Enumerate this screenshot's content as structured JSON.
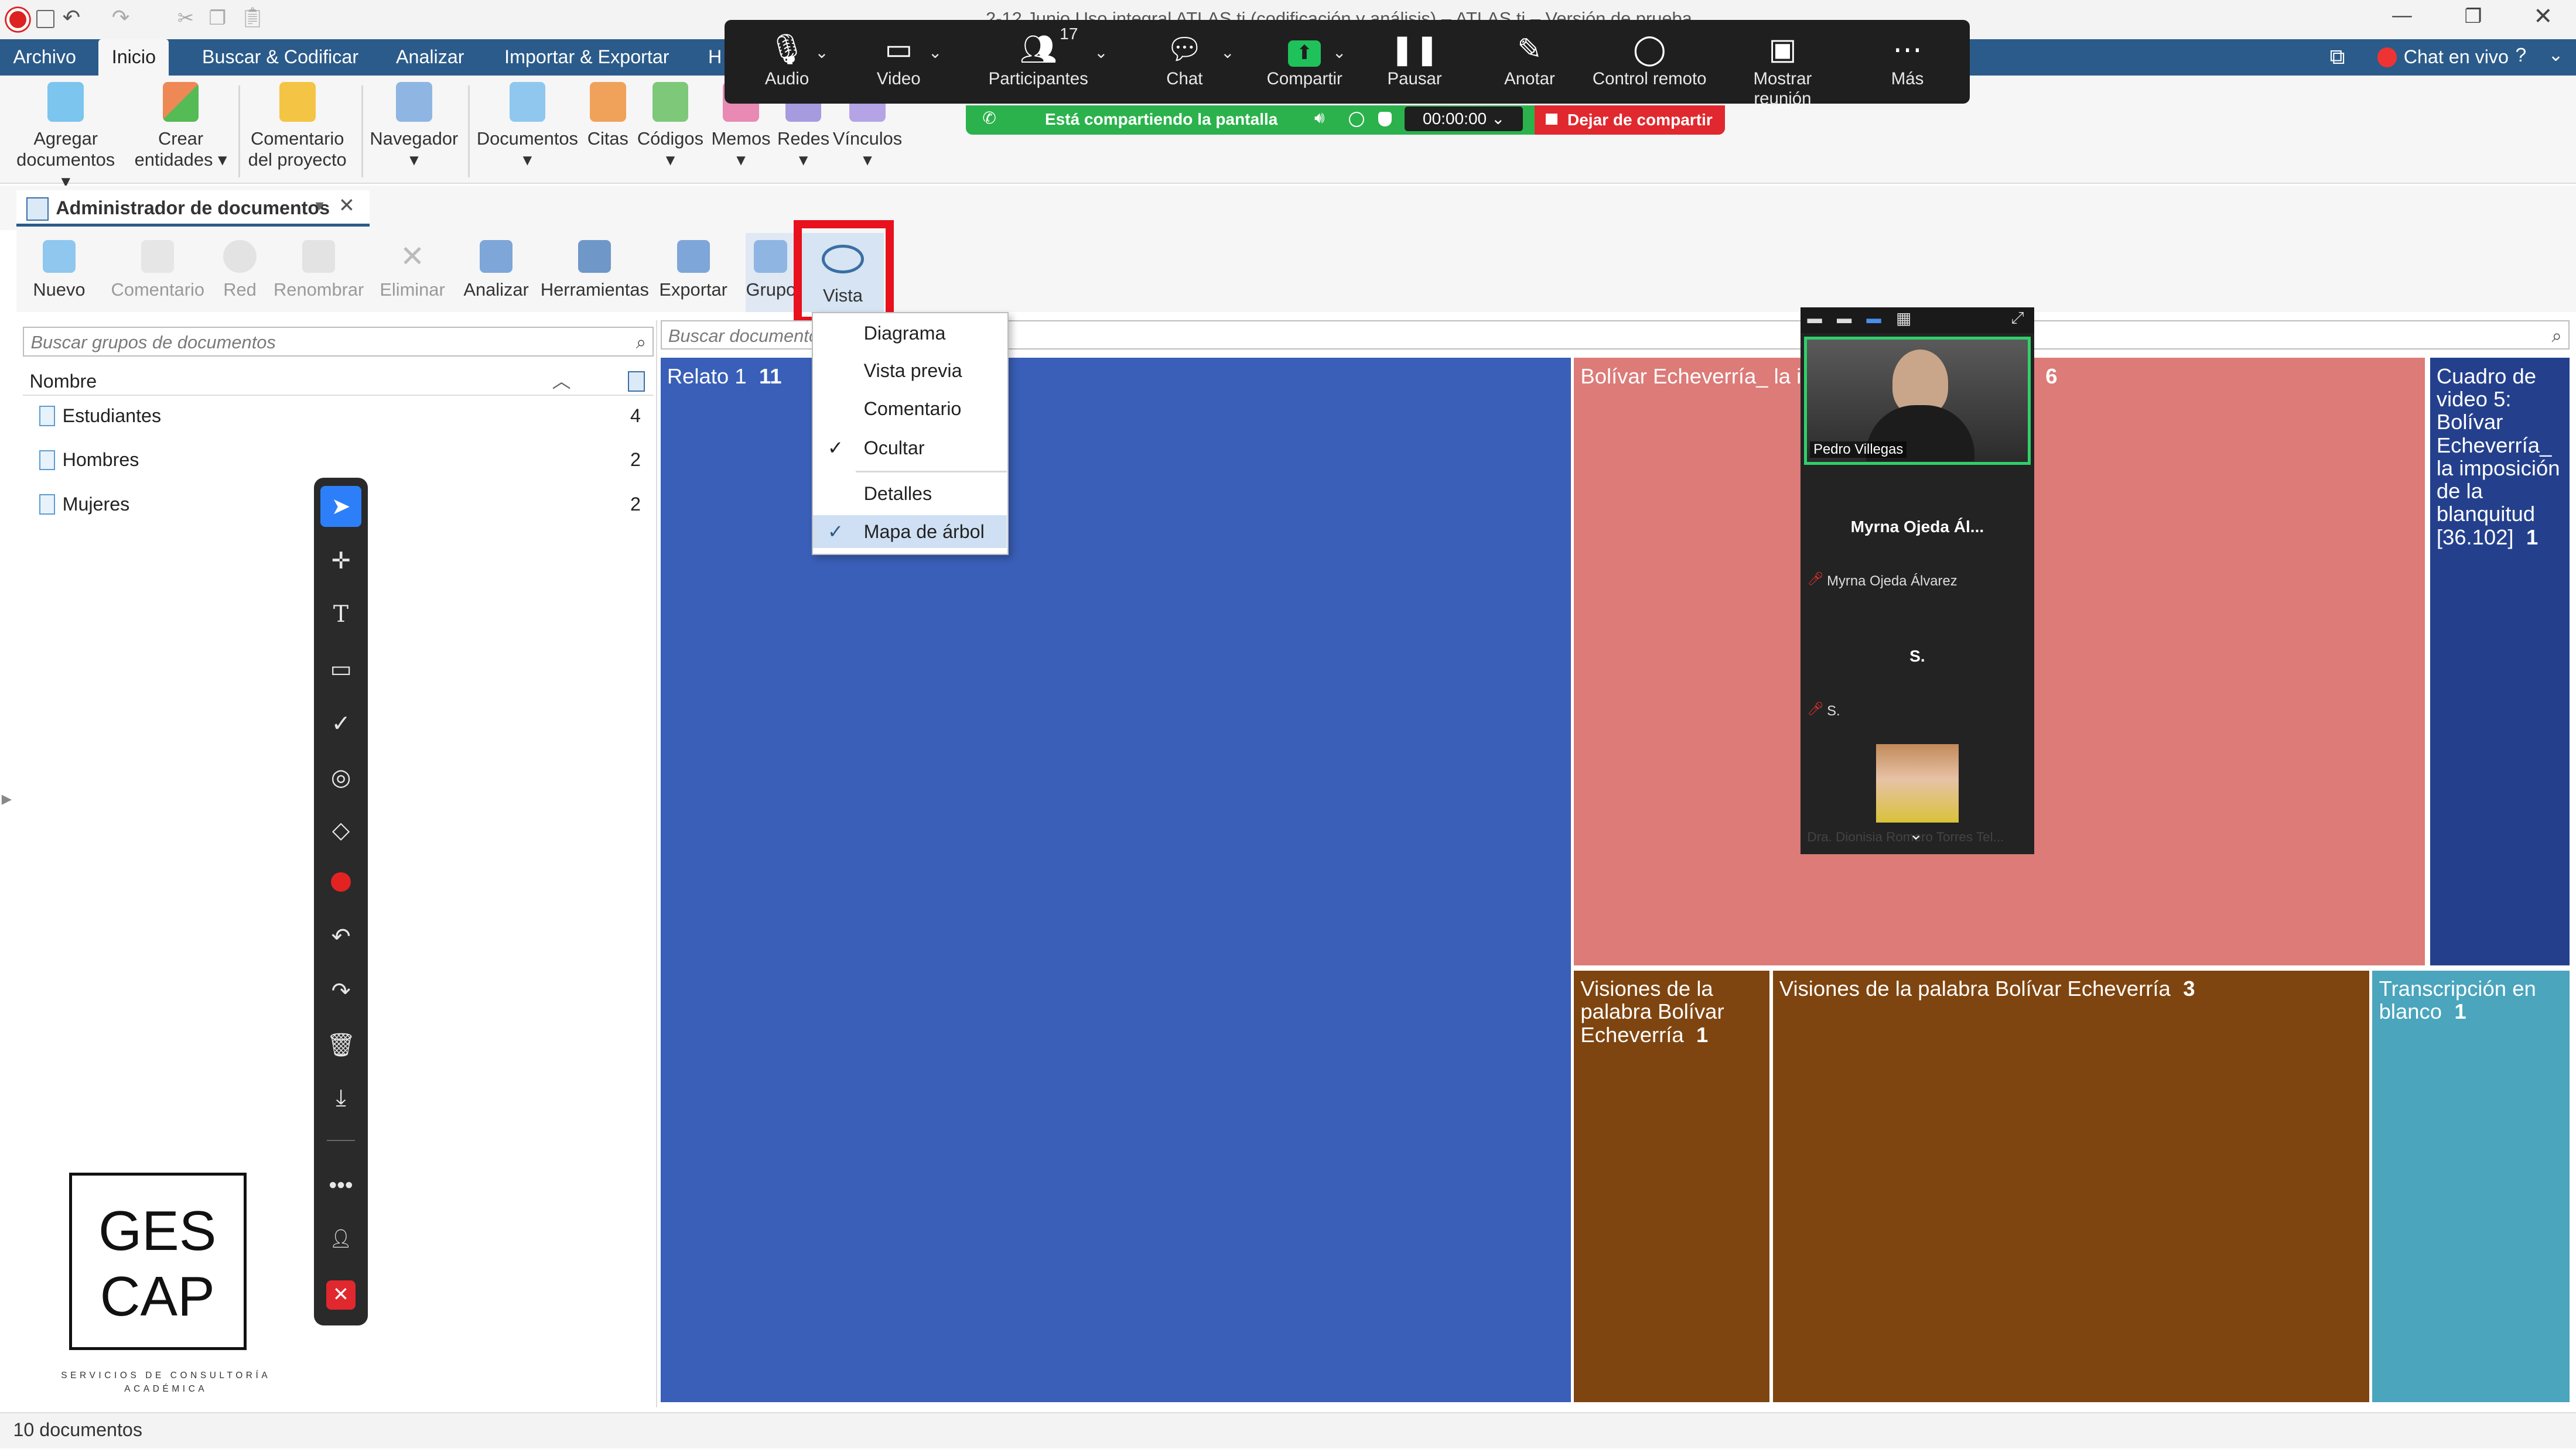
{
  "window": {
    "title": "2-12 Junio Uso integral ATLAS.ti (codificación y análisis) – ATLAS.ti – Versión de prueba"
  },
  "menubar": {
    "items": [
      "Archivo",
      "Inicio",
      "Buscar & Codificar",
      "Analizar",
      "Importar & Exportar",
      "H"
    ],
    "chat_label": "Chat en vivo"
  },
  "ribbon": {
    "buttons": [
      {
        "label": "Agregar\ndocumentos",
        "icon": "add-document-icon"
      },
      {
        "label": "Crear\nentidades",
        "icon": "create-entities-icon"
      },
      {
        "label": "Comentario\ndel proyecto",
        "icon": "comment-icon"
      },
      {
        "label": "Navegador",
        "icon": "navigator-icon"
      },
      {
        "label": "Documentos",
        "icon": "documents-icon"
      },
      {
        "label": "Citas",
        "icon": "quotes-icon"
      },
      {
        "label": "Códigos",
        "icon": "codes-icon"
      },
      {
        "label": "Memos",
        "icon": "memos-icon"
      },
      {
        "label": "Redes",
        "icon": "networks-icon"
      },
      {
        "label": "Vínculos",
        "icon": "links-icon"
      }
    ]
  },
  "doc_manager": {
    "tab_title": "Administrador de documentos",
    "toolbar": [
      {
        "label": "Nuevo",
        "enabled": true
      },
      {
        "label": "Comentario",
        "enabled": false
      },
      {
        "label": "Red",
        "enabled": false
      },
      {
        "label": "Renombrar",
        "enabled": false
      },
      {
        "label": "Eliminar",
        "enabled": false
      },
      {
        "label": "Analizar",
        "enabled": true
      },
      {
        "label": "Herramientas",
        "enabled": true
      },
      {
        "label": "Exportar",
        "enabled": true
      },
      {
        "label": "Grupo",
        "enabled": true
      },
      {
        "label": "Vista",
        "enabled": true
      }
    ],
    "group_search_placeholder": "Buscar grupos de documentos",
    "doc_search_placeholder": "Buscar documentos",
    "column_name": "Nombre",
    "groups": [
      {
        "name": "Estudiantes",
        "count": "4"
      },
      {
        "name": "Hombres",
        "count": "2"
      },
      {
        "name": "Mujeres",
        "count": "2"
      }
    ],
    "status": "10 documentos"
  },
  "view_menu": {
    "items": [
      {
        "label": "Diagrama",
        "checked": false
      },
      {
        "label": "Vista previa",
        "checked": false
      },
      {
        "label": "Comentario",
        "checked": false
      },
      {
        "label": "Ocultar",
        "checked": true
      },
      {
        "label": "Detalles",
        "checked": false
      },
      {
        "label": "Mapa de árbol",
        "checked": true
      }
    ]
  },
  "treemap": [
    {
      "title": "Relato 1",
      "count": "11",
      "color": "#3a5fb8"
    },
    {
      "title": "Bolívar Echeverría_ la im",
      "count": "6",
      "color": "#dc7b78"
    },
    {
      "title": "Cuadro de video 5: Bolívar Echeverría_ la imposición de la blanquitud [36.102]",
      "count": "1",
      "color": "#24408d"
    },
    {
      "title": "Visiones de la palabra Bolívar Echeverría",
      "count": "1",
      "color": "#7f4510"
    },
    {
      "title": "Visiones de la palabra Bolívar Echeverría",
      "count": "3",
      "color": "#7f4510"
    },
    {
      "title": "Transcripción en blanco",
      "count": "1",
      "color": "#4aa5bd"
    }
  ],
  "zoom": {
    "participants_count": "17",
    "buttons": [
      "Audio",
      "Video",
      "Participantes",
      "Chat",
      "Compartir",
      "Pausar",
      "Anotar",
      "Control remoto",
      "Mostrar reunión",
      "Más"
    ],
    "share_status": "Está compartiendo la pantalla",
    "timer": "00:00:00",
    "stop_label": "Dejar de compartir"
  },
  "video_panel": {
    "participant1": "Pedro Villegas",
    "participant2_title": "Myrna Ojeda Ál...",
    "participant2_name": "Myrna Ojeda Álvarez",
    "participant3_title": "S.",
    "participant3_name": "S.",
    "participant4": "Dra. Dionisia Romero Torres Tel..."
  },
  "logo": {
    "line1": "GES",
    "line2": "CAP",
    "tagline": "SERVICIOS DE CONSULTORÍA ACADÉMICA"
  }
}
